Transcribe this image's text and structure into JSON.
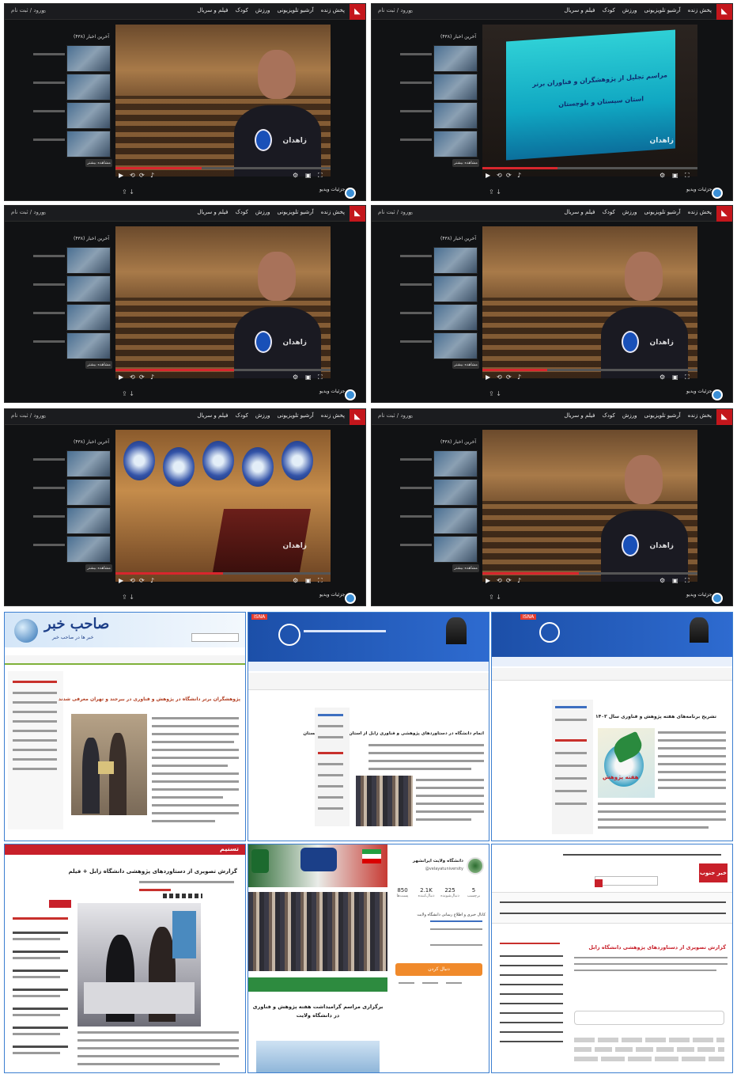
{
  "player": {
    "nav_items": [
      "پخش زنده",
      "آرشیو تلویزیونی",
      "ورزش",
      "کودک",
      "فیلم و سریال"
    ],
    "login_label": "ورود / ثبت نام",
    "playlist_title": "آخرین اخبار (۴۳۸)",
    "more_button": "مشاهده بیشتر",
    "channel_label": "خبرگزاری صدا و سیما",
    "footer_title": "جزئیات ویدیو",
    "watermark": "زاهدان",
    "logo_char": "◣"
  },
  "screen_banner": {
    "line1": "مراسم تجلیل از پژوهشگران و فناوران برتر",
    "line2": "استان سیستان و بلوچستان"
  },
  "videos": [
    {
      "scene": "banner",
      "progress": 0.35
    },
    {
      "scene": "reporter1",
      "progress": 0.4
    },
    {
      "scene": "reporter2",
      "progress": 0.3
    },
    {
      "scene": "reporter3",
      "progress": 0.55
    },
    {
      "scene": "reporter4",
      "progress": 0.45
    },
    {
      "scene": "awards",
      "progress": 0.5
    }
  ],
  "news": {
    "sahebkhabar": {
      "site_name": "صاحب خبر",
      "tagline": "خبر ها در صاحب خبر",
      "headline": "پژوهشگران برتر دانشگاه در پژوهش و فناوری در بیرجند و تهران معرفی شدند"
    },
    "isna1": {
      "site_name": "ISNA",
      "headline": "اتمام دانشگاه در دستاوردهای پژوهشی و فناوری زابل از استان سیستان و بلوچستان"
    },
    "isna2": {
      "site_name": "ISNA",
      "headline": "تشریح برنامه‌های هفته پژوهش و فناوری سال ۱۴۰۳",
      "badge": "هفته پژوهش"
    },
    "tasnim": {
      "site_name": "تسنیم",
      "headline": "گزارش تصویری از دستاوردهای پژوهشی دانشگاه زابل + فیلم"
    },
    "velayat": {
      "uni_name": "دانشگاه ولایت ایرانشهر",
      "handle": "@velayatuniversity",
      "stats": [
        {
          "value": "850",
          "label": "پست‌ها"
        },
        {
          "value": "2.1K",
          "label": "دنبال‌کننده"
        },
        {
          "value": "225",
          "label": "دنبال‌شونده"
        },
        {
          "value": "5",
          "label": "برچسب"
        }
      ],
      "follow_button": "دنبال کردن",
      "caption": "برگزاری مراسم گرامیداشت هفته پژوهش و فناوری در دانشگاه ولایت",
      "channel_text": "کانال خبری و اطلاع رسانی دانشگاه ولایت"
    },
    "kayhan": {
      "site_name": "خبر جنوب",
      "headline": "گزارش تصویری از دستاوردهای پژوهشی دانشگاه زابل"
    }
  }
}
